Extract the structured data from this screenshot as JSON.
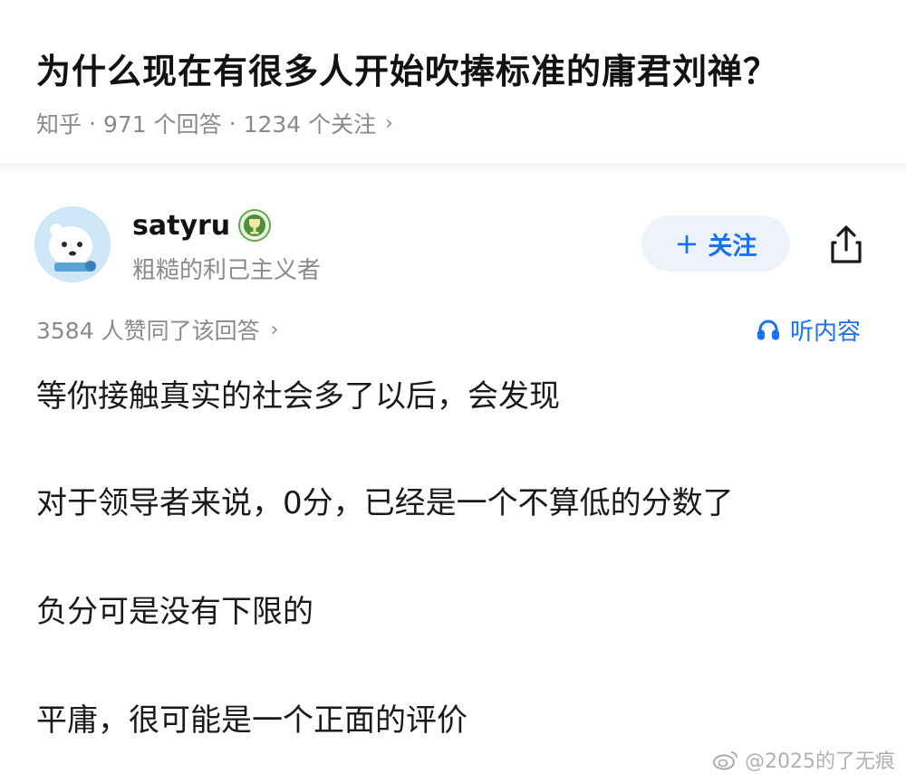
{
  "question": {
    "title": "为什么现在有很多人开始吹捧标准的庸君刘禅？",
    "source": "知乎",
    "answers": "971 个回答",
    "followers": "1234 个关注"
  },
  "author": {
    "name": "satyru",
    "bio": "粗糙的利己主义者",
    "badge_icon": "trophy-badge-icon"
  },
  "actions": {
    "follow_label": "关注",
    "listen_label": "听内容"
  },
  "votes": {
    "text": "3584 人赞同了该回答"
  },
  "answer": {
    "paragraphs": [
      "等你接触真实的社会多了以后，会发现",
      "对于领导者来说，0分，已经是一个不算低的分数了",
      "负分可是没有下限的",
      "平庸，很可能是一个正面的评价"
    ]
  },
  "watermark": {
    "text": "@2025的了无痕"
  },
  "colors": {
    "accent": "#1772f6",
    "follow_bg": "#eef3fb",
    "muted": "#8a8a8a"
  }
}
